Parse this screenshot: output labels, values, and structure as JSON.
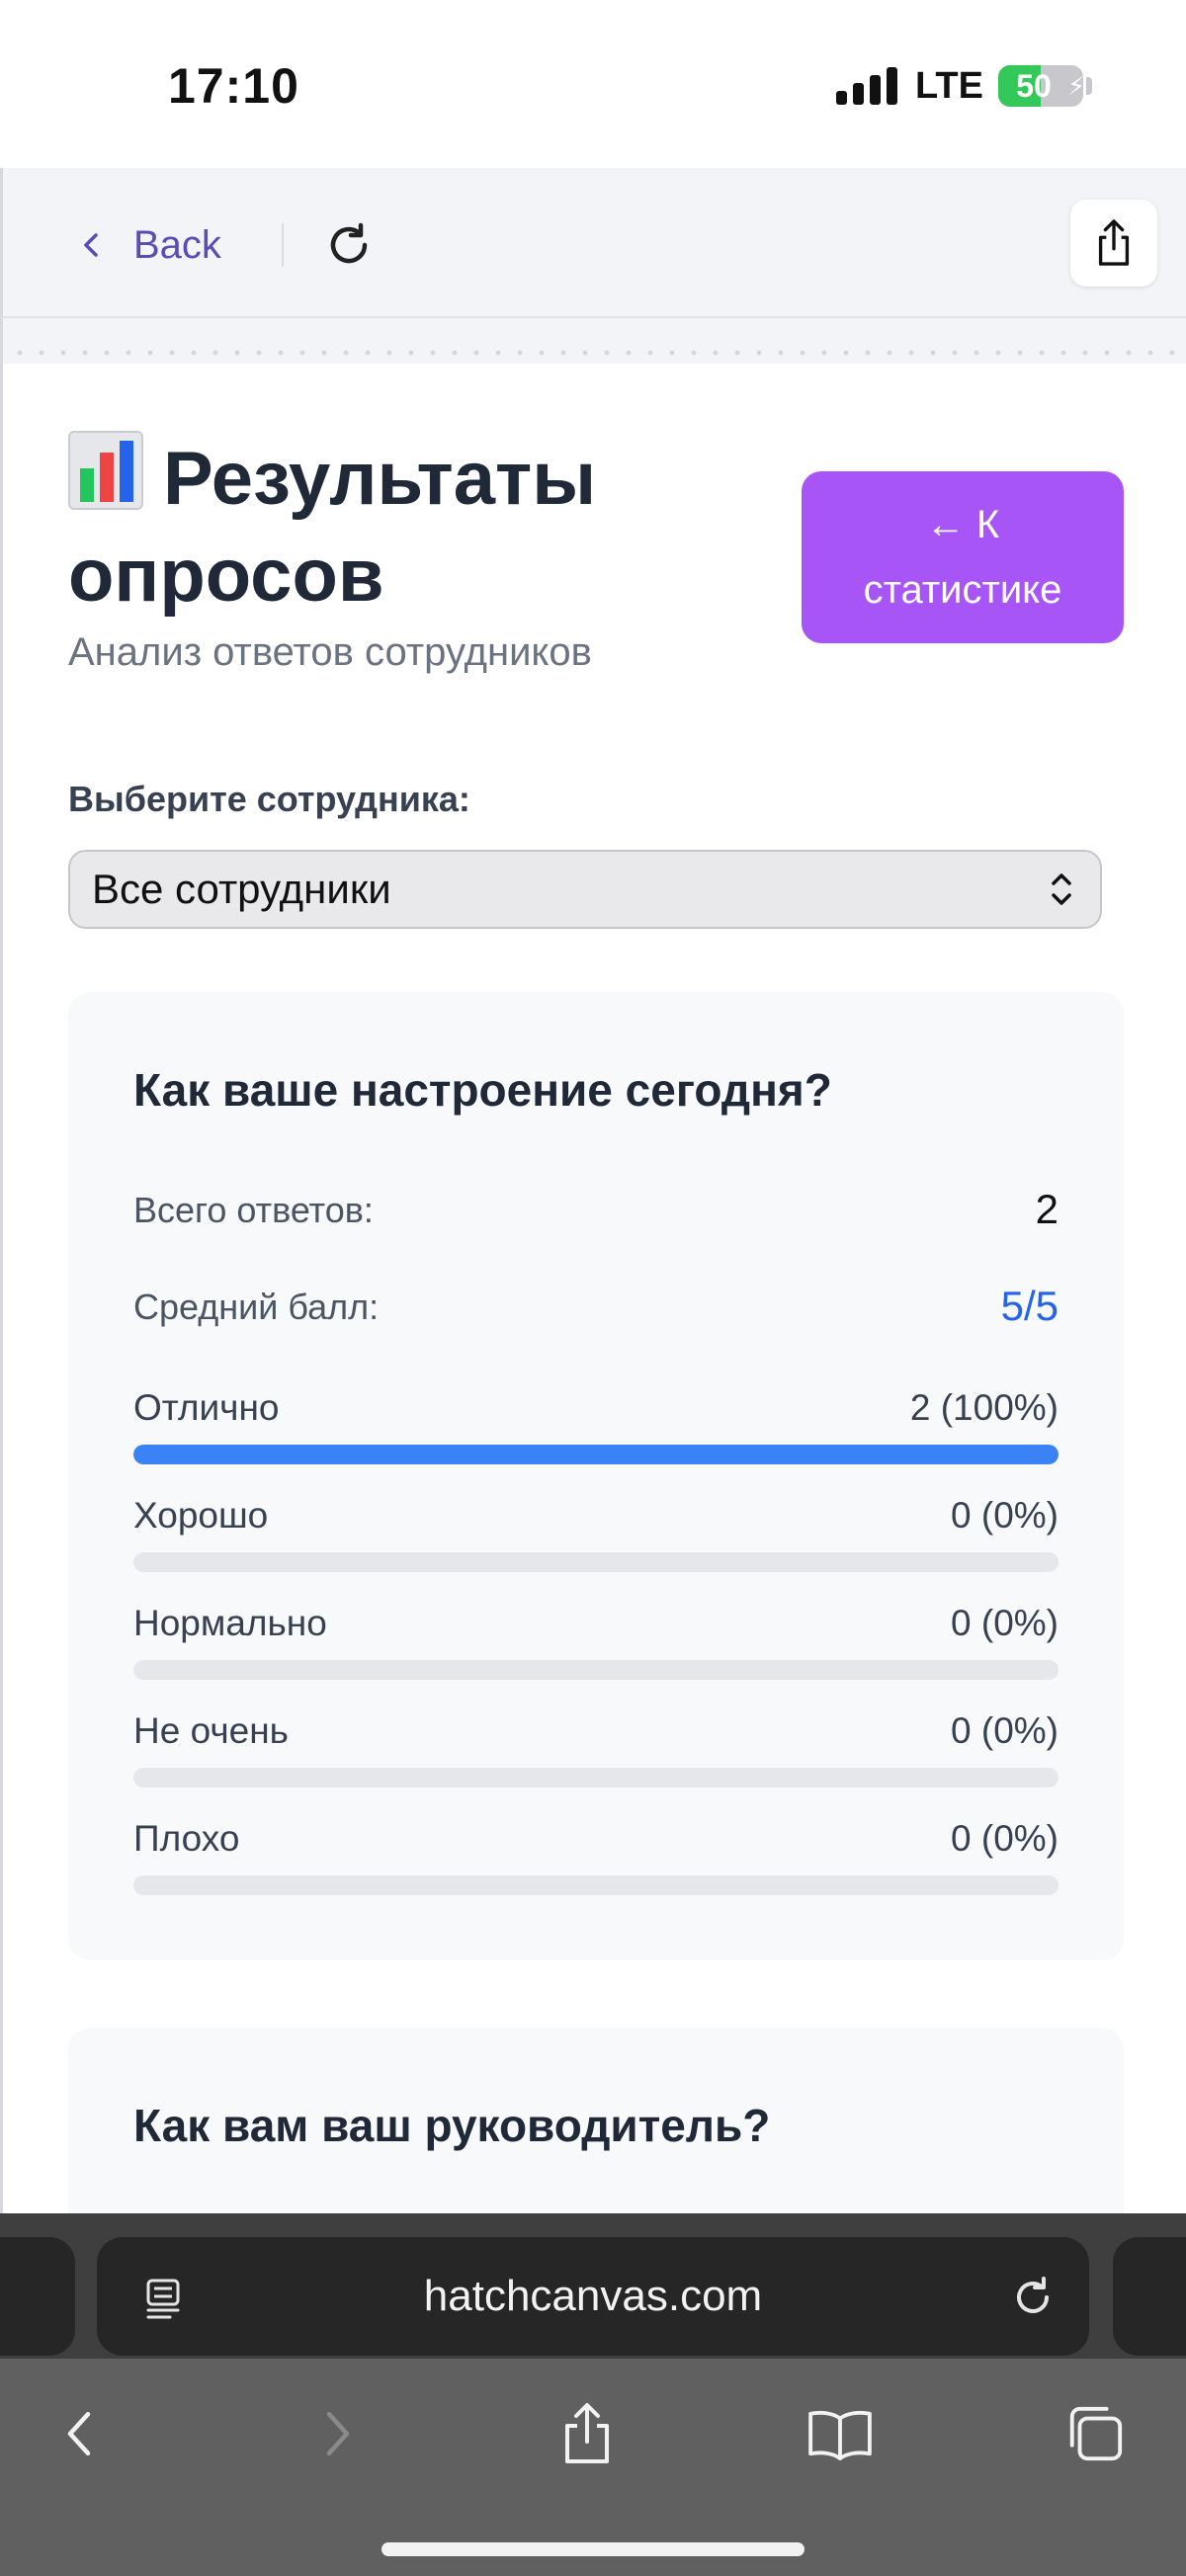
{
  "status_bar": {
    "time": "17:10",
    "network": "LTE",
    "battery": "50"
  },
  "toolbar": {
    "back_label": "Back"
  },
  "header": {
    "title": "Результаты опросов",
    "subtitle": "Анализ ответов сотрудников",
    "stats_button_arrow": "← К",
    "stats_button_text": "статистике"
  },
  "filter": {
    "label": "Выберите сотрудника:",
    "selected": "Все сотрудники"
  },
  "surveys": [
    {
      "question": "Как ваше настроение сегодня?",
      "total_label": "Всего ответов:",
      "total_value": "2",
      "avg_label": "Средний балл:",
      "avg_value": "5/5",
      "options": [
        {
          "label": "Отлично",
          "count": "2 (100%)",
          "fraction": 1.0
        },
        {
          "label": "Хорошо",
          "count": "0 (0%)",
          "fraction": 0
        },
        {
          "label": "Нормально",
          "count": "0 (0%)",
          "fraction": 0
        },
        {
          "label": "Не очень",
          "count": "0 (0%)",
          "fraction": 0
        },
        {
          "label": "Плохо",
          "count": "0 (0%)",
          "fraction": 0
        }
      ]
    },
    {
      "question": "Как вам ваш руководитель?"
    }
  ],
  "browser": {
    "url": "hatchcanvas.com"
  },
  "colors": {
    "accent_purple": "#a855f7",
    "link_purple": "#5b4bb7",
    "bar_blue": "#3b82f6",
    "avg_blue": "#2563eb"
  }
}
